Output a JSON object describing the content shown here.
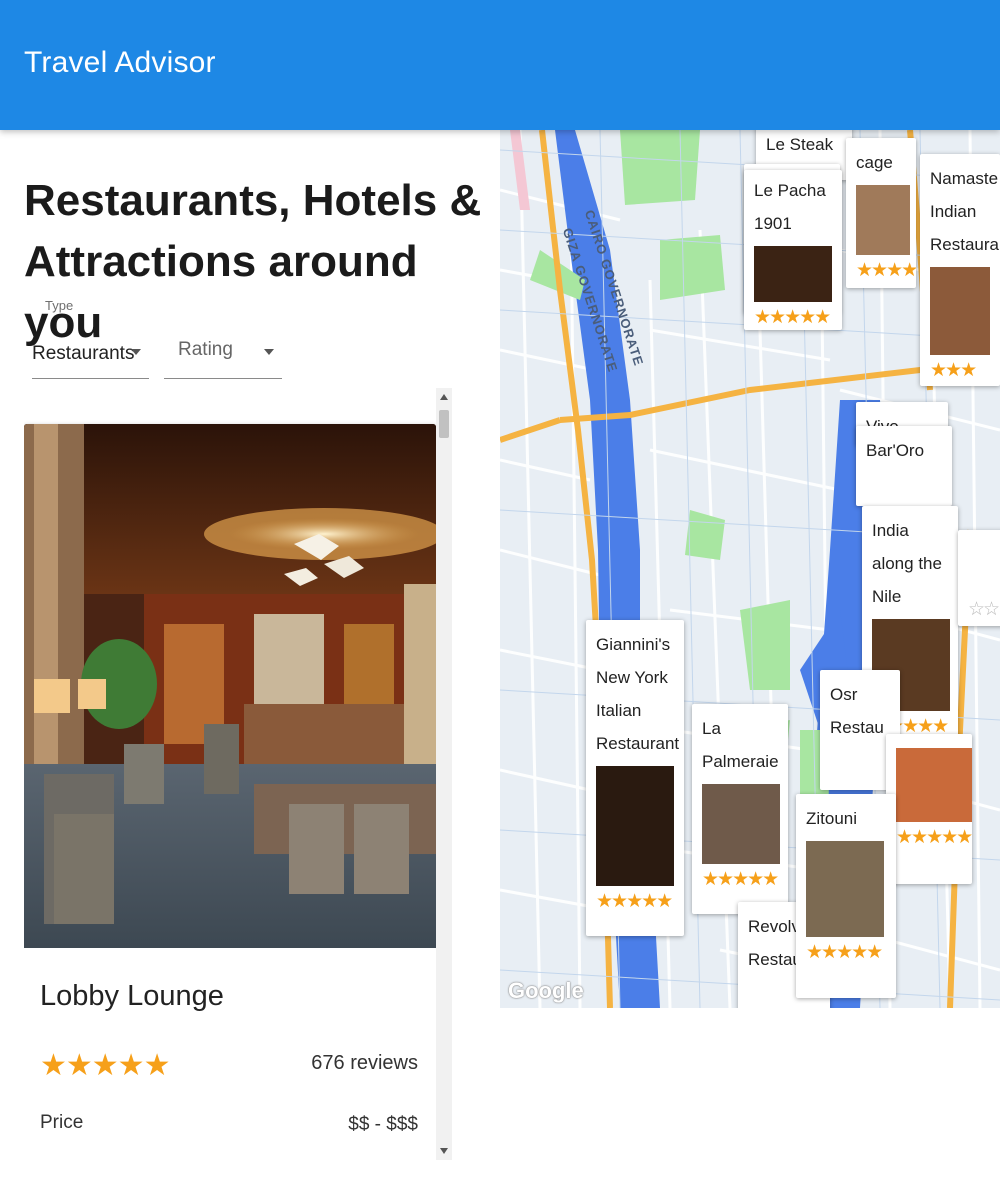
{
  "app": {
    "title": "Travel Advisor"
  },
  "main": {
    "headline": "Restaurants, Hotels & Attractions around you",
    "type_label": "Type",
    "type_value": "Restaurants",
    "rating_value": "Rating"
  },
  "place_card": {
    "name": "Lobby Lounge",
    "stars": "★★★★★",
    "reviews": "676 reviews",
    "price_label": "Price",
    "price": "$$ - $$$"
  },
  "map": {
    "attribution": "Google",
    "gov_labels": [
      "CAIRO GOVERNORATE",
      "GIZA GOVERNORATE"
    ],
    "pins": [
      {
        "name": "Le Steak",
        "stars": ""
      },
      {
        "name": "Le Pacha 1901",
        "stars": "★★★★★"
      },
      {
        "name": "cage",
        "stars": "★★★★"
      },
      {
        "name": "Namaste Indian Restaurant",
        "stars": "★★★"
      },
      {
        "name": "Vivo - The",
        "stars": ""
      },
      {
        "name": "Bar'Oro",
        "stars": ""
      },
      {
        "name": "India along the Nile",
        "stars": "★★★★★"
      },
      {
        "name": "Giannini's New York Italian Restaurant",
        "stars": "★★★★★"
      },
      {
        "name": "La Palmeraie",
        "stars": "★★★★★"
      },
      {
        "name": "Osr Restau",
        "stars": ""
      },
      {
        "name": "Zitouni",
        "stars": "★★★★★"
      },
      {
        "name": "Revolvin Restaura",
        "stars": ""
      }
    ],
    "extra_stars": "★★★★★",
    "empty_stars": "☆☆",
    "colors": {
      "water": "#4b7ee8",
      "road": "#f5b342",
      "park": "#a8e6a1"
    }
  },
  "colors": {
    "appbar": "#1e88e5",
    "star": "#f6a01a"
  }
}
